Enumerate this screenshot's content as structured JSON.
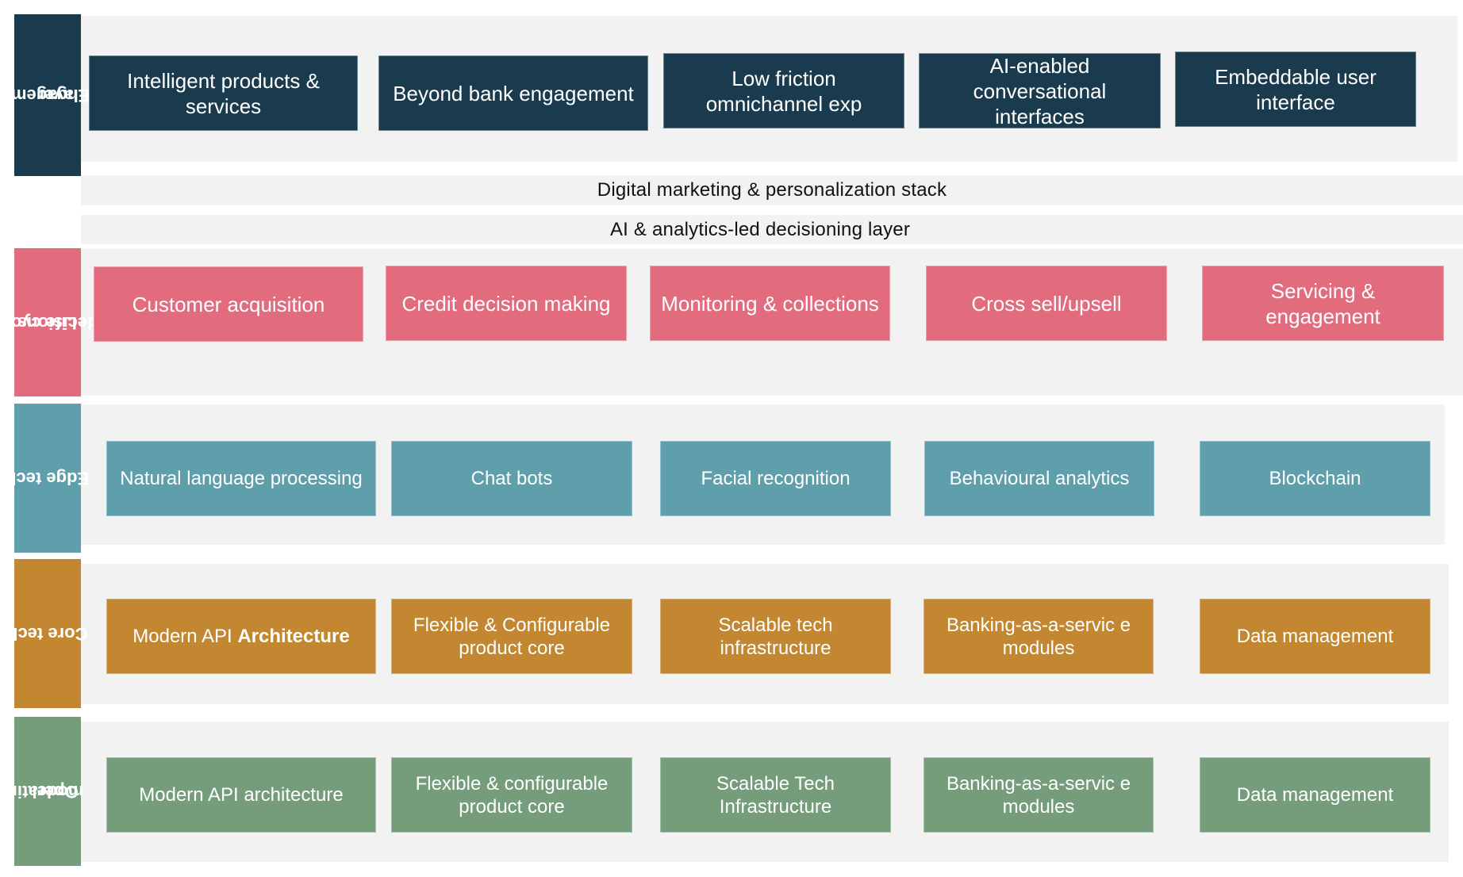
{
  "colors": {
    "engagement": "#1a3b4e",
    "lifecycle": "#e26b7d",
    "edge": "#5f9fac",
    "core": "#c38731",
    "operating": "#759d7b",
    "row_background": "#f2f2f2"
  },
  "bands": {
    "digital_marketing": "Digital marketing & personalization stack",
    "ai_analytics": "AI & analytics-led decisioning layer"
  },
  "layers": {
    "engagement": {
      "label_line1": "Engagement",
      "label_line2": "layer",
      "items": [
        "Intelligent products & services",
        "Beyond bank engagement",
        "Low friction omnichannel exp",
        "AI-enabled conversational interfaces",
        "Embeddable user interface"
      ]
    },
    "lifecycle": {
      "label_line1": "Life cycle",
      "label_line2": "decisions",
      "items": [
        "Customer acquisition",
        "Credit decision making",
        "Monitoring & collections",
        "Cross sell/upsell",
        "Servicing & engagement"
      ]
    },
    "edge": {
      "label_line1": "Edge tech",
      "items": [
        "Natural language processing",
        "Chat bots",
        "Facial recognition",
        "Behavioural analytics",
        "Blockchain"
      ]
    },
    "core": {
      "label_line1": "Core tech",
      "item0_plain": "Modern API ",
      "item0_bold": "Architecture",
      "items": [
        "Modern API Architecture",
        "Flexible & Configurable product core",
        "Scalable tech infrastructure",
        "Banking-as-a-servic e modules",
        "Data management"
      ]
    },
    "operating": {
      "label_line1": "Operating",
      "label_line2": "model",
      "items": [
        "Modern API architecture",
        "Flexible & configurable product core",
        "Scalable Tech Infrastructure",
        "Banking-as-a-servic e modules",
        "Data management"
      ]
    }
  }
}
